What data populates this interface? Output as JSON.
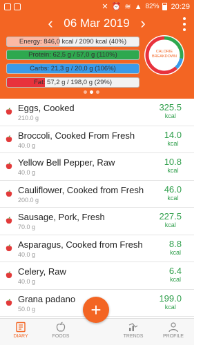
{
  "status_bar": {
    "battery": "82%",
    "time": "20:29"
  },
  "header": {
    "date": "06 Mar 2019",
    "prev_icon": "chevron-left-icon",
    "next_icon": "chevron-right-icon",
    "menu_icon": "more-vertical-icon",
    "accent_color": "#f36523"
  },
  "macro_bars": {
    "energy": {
      "label": "Energy: 846,0 kcal  /  2090 kcal (40%)",
      "fraction": 0.4,
      "color": "#fbb9a5"
    },
    "protein": {
      "label": "Protein: 62,5 g  /  57,0 g (110%)",
      "fraction": 1.0,
      "color": "#2ea84f"
    },
    "carbs": {
      "label": "Carbs: 21,3 g  /  20,0 g (106%)",
      "fraction": 1.0,
      "color": "#3b9ae8"
    },
    "fat": {
      "label": "Fat: 57,2 g  /  198,0 g (29%)",
      "fraction": 0.29,
      "color": "#e8323c"
    }
  },
  "pager": {
    "pages": 3,
    "active_index": 1
  },
  "calorie_breakdown": {
    "label_line1": "CALORIE",
    "label_line2": "BREAKDOWN",
    "segments": [
      {
        "name": "Protein",
        "fraction": 0.28,
        "color": "#2ea84f"
      },
      {
        "name": "Carbs",
        "fraction": 0.1,
        "color": "#3b9ae8"
      },
      {
        "name": "Fat",
        "fraction": 0.62,
        "color": "#e8323c"
      }
    ]
  },
  "foods": [
    {
      "name": "Eggs, Cooked",
      "weight": "210.0 g",
      "kcal": "325.5",
      "unit": "kcal"
    },
    {
      "name": "Broccoli, Cooked From Fresh",
      "weight": "40.0 g",
      "kcal": "14.0",
      "unit": "kcal"
    },
    {
      "name": "Yellow Bell Pepper, Raw",
      "weight": "40.0 g",
      "kcal": "10.8",
      "unit": "kcal"
    },
    {
      "name": "Cauliflower, Cooked from Fresh",
      "weight": "200.0 g",
      "kcal": "46.0",
      "unit": "kcal"
    },
    {
      "name": "Sausage, Pork, Fresh",
      "weight": "70.0 g",
      "kcal": "227.5",
      "unit": "kcal"
    },
    {
      "name": "Asparagus, Cooked from Fresh",
      "weight": "40.0 g",
      "kcal": "8.8",
      "unit": "kcal"
    },
    {
      "name": "Celery, Raw",
      "weight": "40.0 g",
      "kcal": "6.4",
      "unit": "kcal"
    },
    {
      "name": "Grana padano",
      "weight": "50.0 g",
      "kcal": "199.0",
      "unit": "kcal"
    }
  ],
  "bottom_nav": {
    "diary": "DIARY",
    "foods": "FOODS",
    "trends": "TRENDS",
    "profile": "PROFILE",
    "add_symbol": "+"
  }
}
